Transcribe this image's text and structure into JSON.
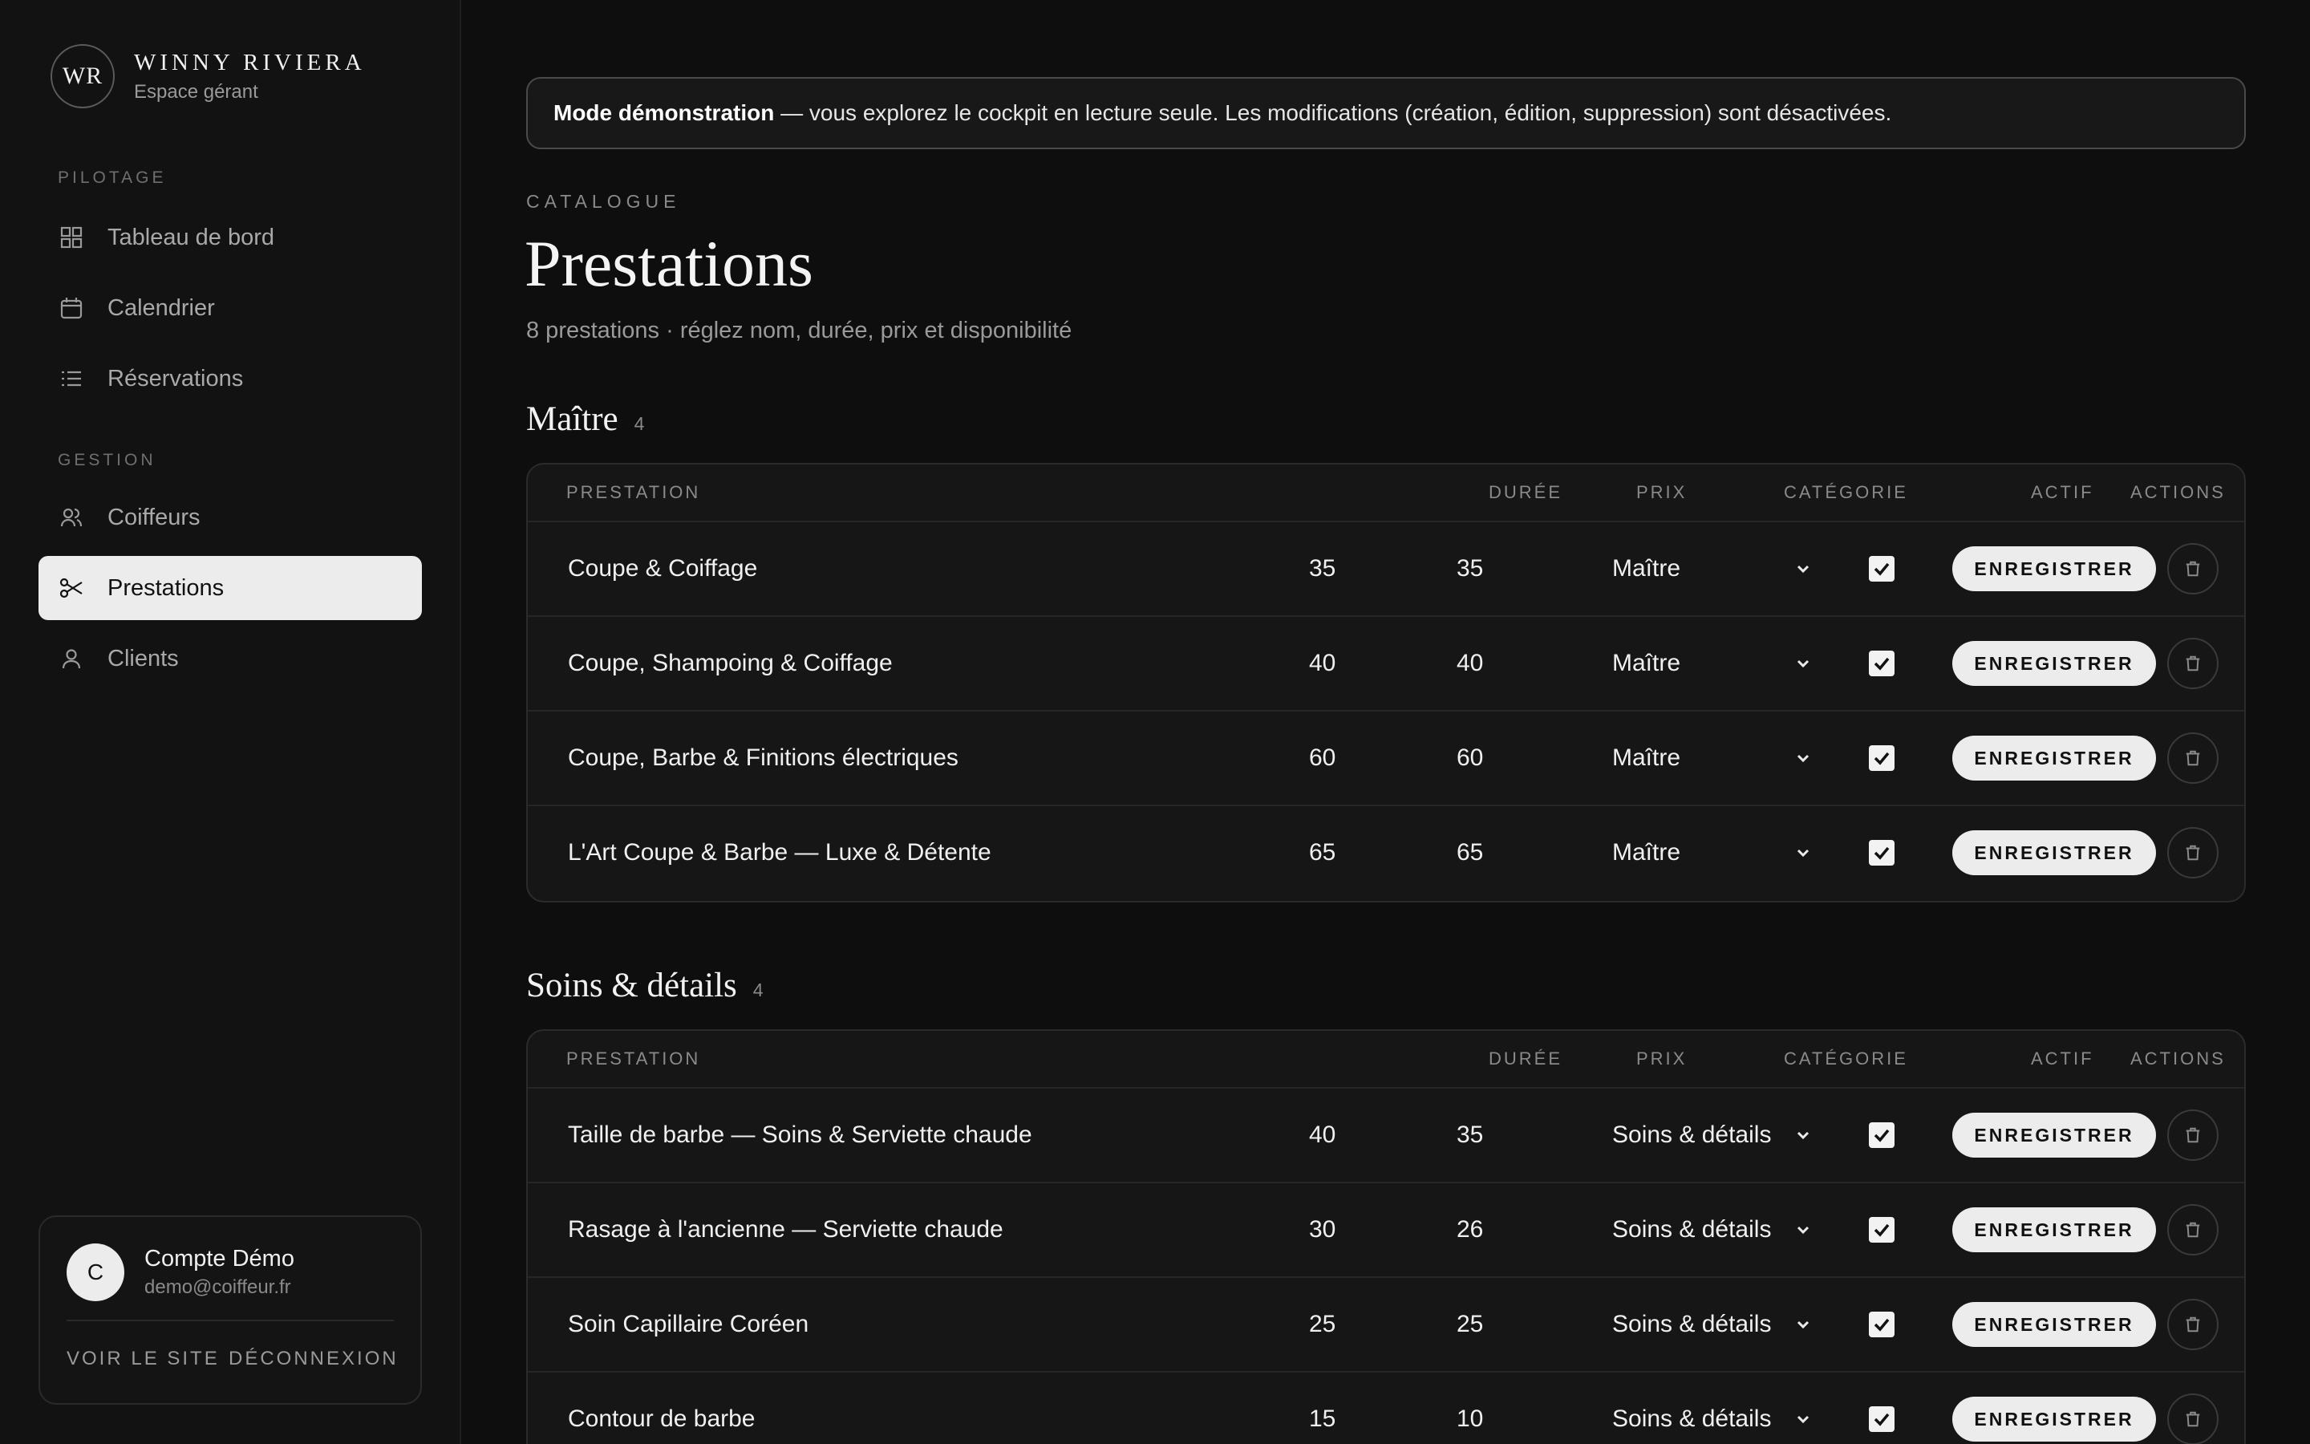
{
  "brand": {
    "mark": "WR",
    "name": "WINNY RIVIERA",
    "subtitle": "Espace gérant"
  },
  "sidebar": {
    "sections": [
      {
        "label": "PILOTAGE",
        "items": [
          {
            "label": "Tableau de bord",
            "icon": "grid-icon"
          },
          {
            "label": "Calendrier",
            "icon": "calendar-icon"
          },
          {
            "label": "Réservations",
            "icon": "list-icon"
          }
        ]
      },
      {
        "label": "GESTION",
        "items": [
          {
            "label": "Coiffeurs",
            "icon": "users-icon"
          },
          {
            "label": "Prestations",
            "icon": "scissors-icon",
            "active": true
          },
          {
            "label": "Clients",
            "icon": "user-icon"
          }
        ]
      }
    ]
  },
  "account": {
    "initial": "C",
    "name": "Compte Démo",
    "email": "demo@coiffeur.fr",
    "view_site": "VOIR LE SITE",
    "logout": "DÉCONNEXION"
  },
  "banner": {
    "bold": "Mode démonstration",
    "text": " — vous explorez le cockpit en lecture seule. Les modifications (création, édition, suppression) sont désactivées."
  },
  "page": {
    "eyebrow": "CATALOGUE",
    "title": "Prestations",
    "subtitle": "8 prestations · réglez nom, durée, prix et disponibilité"
  },
  "columns": {
    "name": "PRESTATION",
    "duration": "DURÉE",
    "price": "PRIX",
    "category": "CATÉGORIE",
    "active": "ACTIF",
    "actions": "ACTIONS"
  },
  "save_label": "ENREGISTRER",
  "groups": [
    {
      "title": "Maître",
      "count": "4",
      "rows": [
        {
          "name": "Coupe & Coiffage",
          "duration": "35",
          "price": "35",
          "category": "Maître",
          "active": true
        },
        {
          "name": "Coupe, Shampoing & Coiffage",
          "duration": "40",
          "price": "40",
          "category": "Maître",
          "active": true
        },
        {
          "name": "Coupe, Barbe & Finitions électriques",
          "duration": "60",
          "price": "60",
          "category": "Maître",
          "active": true
        },
        {
          "name": "L'Art Coupe & Barbe — Luxe & Détente",
          "duration": "65",
          "price": "65",
          "category": "Maître",
          "active": true
        }
      ]
    },
    {
      "title": "Soins & détails",
      "count": "4",
      "rows": [
        {
          "name": "Taille de barbe — Soins & Serviette chaude",
          "duration": "40",
          "price": "35",
          "category": "Soins & détails",
          "active": true
        },
        {
          "name": "Rasage à l'ancienne — Serviette chaude",
          "duration": "30",
          "price": "26",
          "category": "Soins & détails",
          "active": true
        },
        {
          "name": "Soin Capillaire Coréen",
          "duration": "25",
          "price": "25",
          "category": "Soins & détails",
          "active": true
        },
        {
          "name": "Contour de barbe",
          "duration": "15",
          "price": "10",
          "category": "Soins & détails",
          "active": true
        }
      ]
    }
  ]
}
